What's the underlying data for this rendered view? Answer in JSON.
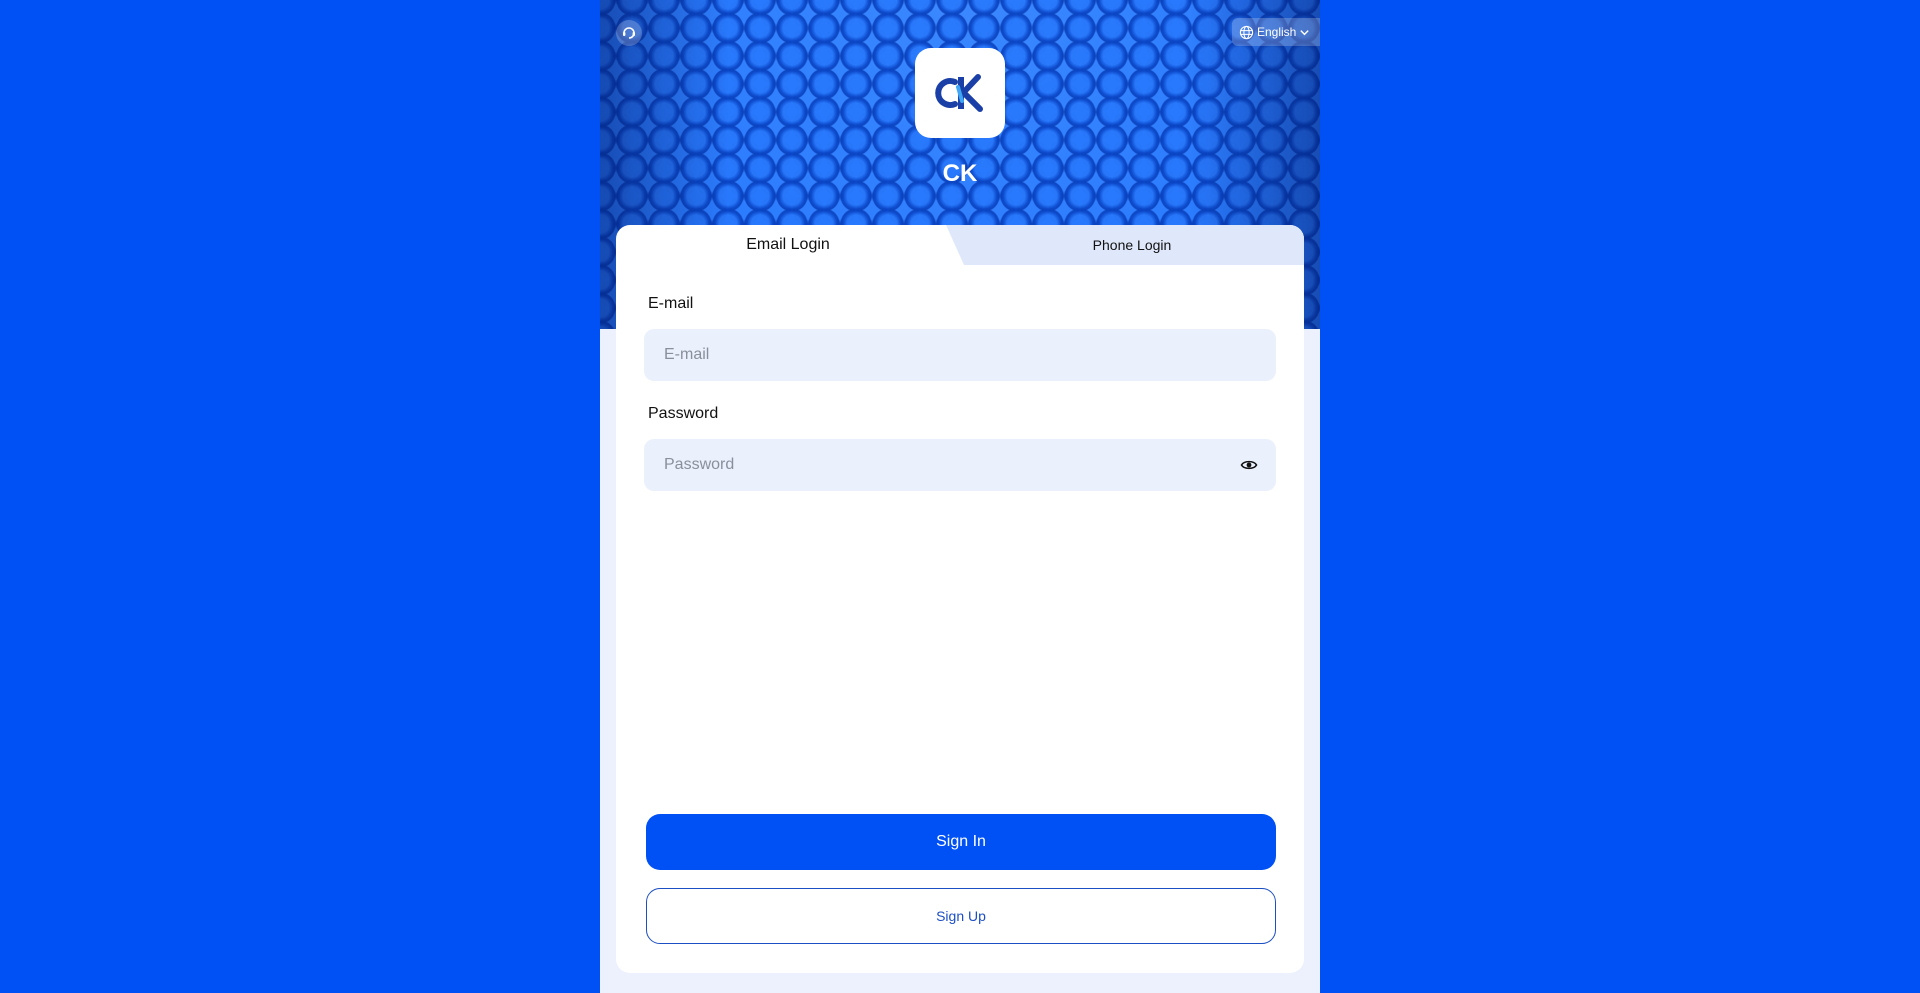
{
  "header": {
    "support_icon": "headset-refresh-icon",
    "language": {
      "icon": "globe-icon",
      "label": "English",
      "chevron": "chevron-down-icon"
    }
  },
  "brand": {
    "logo_text": "CK",
    "app_name": "CK",
    "colors": {
      "logo_dark": "#1a3fa6",
      "logo_light": "#3ea6f5",
      "primary": "#0051f5"
    }
  },
  "tabs": [
    {
      "label": "Email Login",
      "active": true
    },
    {
      "label": "Phone Login",
      "active": false
    }
  ],
  "form": {
    "email": {
      "label": "E-mail",
      "placeholder": "E-mail",
      "value": ""
    },
    "password": {
      "label": "Password",
      "placeholder": "Password",
      "value": "",
      "toggle_icon": "eye-icon"
    }
  },
  "actions": {
    "sign_in": "Sign In",
    "sign_up": "Sign Up"
  }
}
